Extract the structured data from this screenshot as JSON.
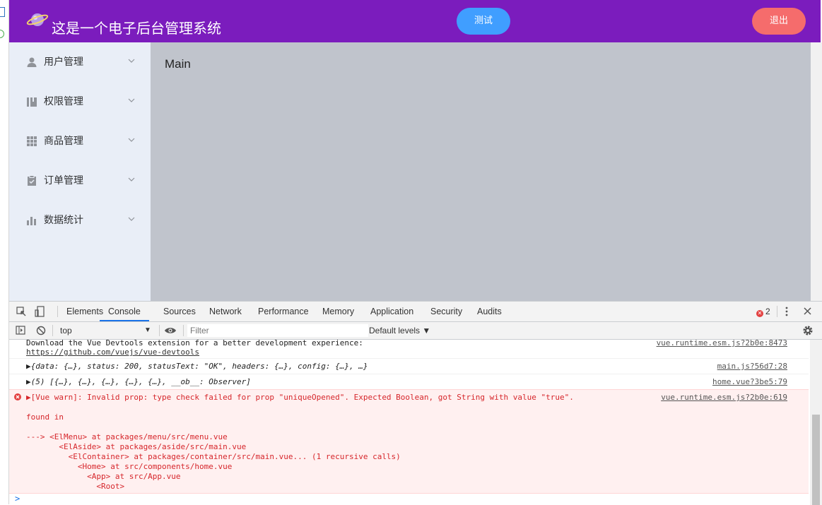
{
  "header": {
    "title": "这是一个电子后台管理系统",
    "test_button": "测试",
    "logout_button": "退出"
  },
  "sidebar": {
    "items": [
      {
        "label": "用户管理",
        "icon": "user-icon"
      },
      {
        "label": "权限管理",
        "icon": "lock-panel-icon"
      },
      {
        "label": "商品管理",
        "icon": "grid-icon"
      },
      {
        "label": "订单管理",
        "icon": "clipboard-icon"
      },
      {
        "label": "数据统计",
        "icon": "bar-chart-icon"
      }
    ]
  },
  "main": {
    "text": "Main"
  },
  "devtools": {
    "tabs": [
      "Elements",
      "Console",
      "Sources",
      "Network",
      "Performance",
      "Memory",
      "Application",
      "Security",
      "Audits"
    ],
    "active_tab": "Console",
    "error_count": "2",
    "context": "top",
    "filter_placeholder": "Filter",
    "levels": "Default levels ▼",
    "messages": [
      {
        "text": "Download the Vue Devtools extension for a better development experience:",
        "link": "https://github.com/vuejs/vue-devtools",
        "source": "vue.runtime.esm.js?2b0e:8473"
      },
      {
        "text": "▶{data: {…}, status: 200, statusText: \"OK\", headers: {…}, config: {…}, …}",
        "source": "main.js?56d7:28"
      },
      {
        "text": "▶(5) [{…}, {…}, {…}, {…}, {…}, __ob__: Observer]",
        "source": "home.vue?3be5:79"
      },
      {
        "text": "▶[Vue warn]: Invalid prop: type check failed for prop \"uniqueOpened\". Expected Boolean, got String with value \"true\".",
        "source": "vue.runtime.esm.js?2b0e:619",
        "details": [
          "found in",
          "---> <ElMenu> at packages/menu/src/menu.vue",
          "       <ElAside> at packages/aside/src/main.vue",
          "         <ElContainer> at packages/container/src/main.vue... (1 recursive calls)",
          "           <Home> at src/components/home.vue",
          "             <App> at src/App.vue",
          "               <Root>"
        ]
      }
    ],
    "prompt": ">"
  },
  "colors": {
    "header": "#7b1cbd",
    "aside": "#e9eef7",
    "main": "#c0c4cc",
    "primary": "#409eff",
    "danger": "#f56c6c"
  }
}
